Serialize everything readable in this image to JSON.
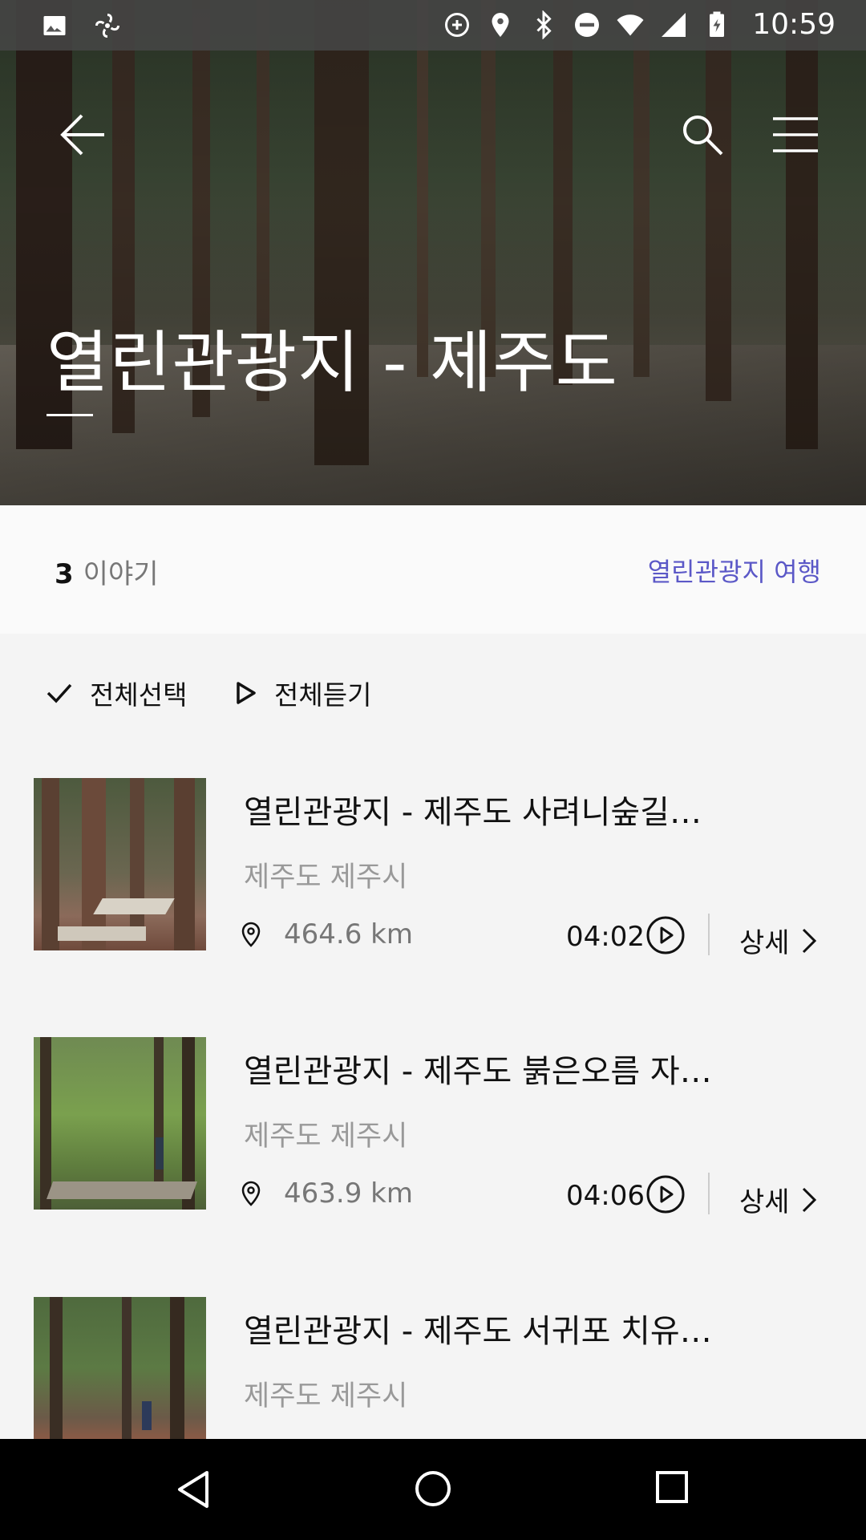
{
  "status_bar": {
    "time": "10:59",
    "left_icons": [
      "gallery-icon",
      "fan-icon"
    ],
    "right_icons": [
      "data-saver-icon",
      "location-icon",
      "bluetooth-icon",
      "do-not-disturb-icon",
      "wifi-icon",
      "signal-icon",
      "battery-charging-icon"
    ]
  },
  "header": {
    "title": "열린관광지 - 제주도"
  },
  "info": {
    "story_count": "3",
    "story_label": "이야기",
    "trip_link": "열린관광지 여행"
  },
  "actions": {
    "select_all": "전체선택",
    "listen_all": "전체듣기"
  },
  "items": [
    {
      "title": "열린관광지 - 제주도 사려니숲길…",
      "location": "제주도 제주시",
      "distance": "464.6 km",
      "duration": "04:02",
      "detail_label": "상세"
    },
    {
      "title": "열린관광지 - 제주도 붉은오름 자…",
      "location": "제주도 제주시",
      "distance": "463.9 km",
      "duration": "04:06",
      "detail_label": "상세"
    },
    {
      "title": "열린관광지 - 제주도 서귀포 치유…",
      "location": "제주도 제주시",
      "distance": "",
      "duration": "",
      "detail_label": ""
    }
  ],
  "colors": {
    "accent": "#5b58c7",
    "background": "#f4f4f4"
  }
}
